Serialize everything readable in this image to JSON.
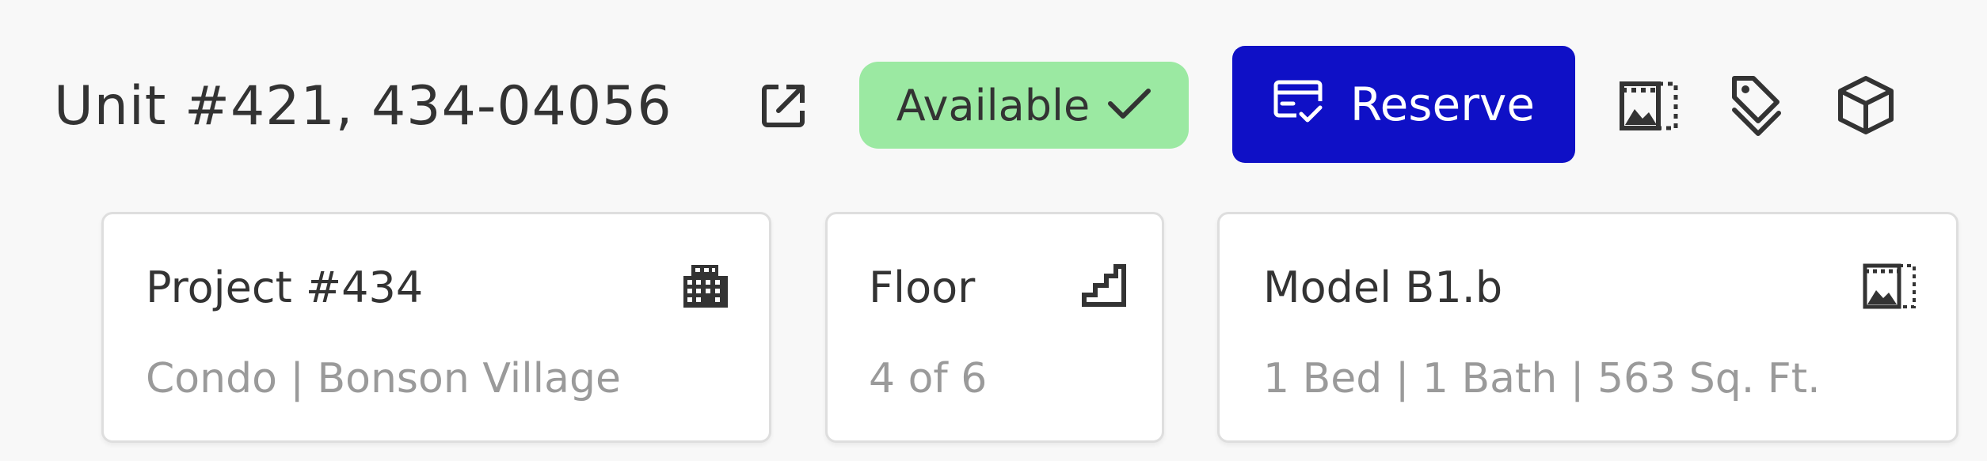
{
  "header": {
    "title": "Unit #421, 434-04056",
    "open_external_icon": "open-in-new-icon",
    "status": {
      "label": "Available",
      "icon": "check-icon",
      "color": "#9be9a2"
    },
    "reserve": {
      "label": "Reserve",
      "icon": "credit-card-check-icon",
      "color": "#0f10c6"
    },
    "actions": [
      {
        "icon": "gallery-icon"
      },
      {
        "icon": "tags-icon"
      },
      {
        "icon": "cube-icon"
      }
    ]
  },
  "cards": [
    {
      "title": "Project #434",
      "subtitle": "Condo | Bonson Village",
      "icon": "building-icon"
    },
    {
      "title": "Floor",
      "subtitle": "4 of 6",
      "icon": "stairs-icon"
    },
    {
      "title": "Model B1.b",
      "subtitle": "1 Bed | 1 Bath | 563 Sq. Ft.",
      "icon": "gallery-icon"
    }
  ]
}
